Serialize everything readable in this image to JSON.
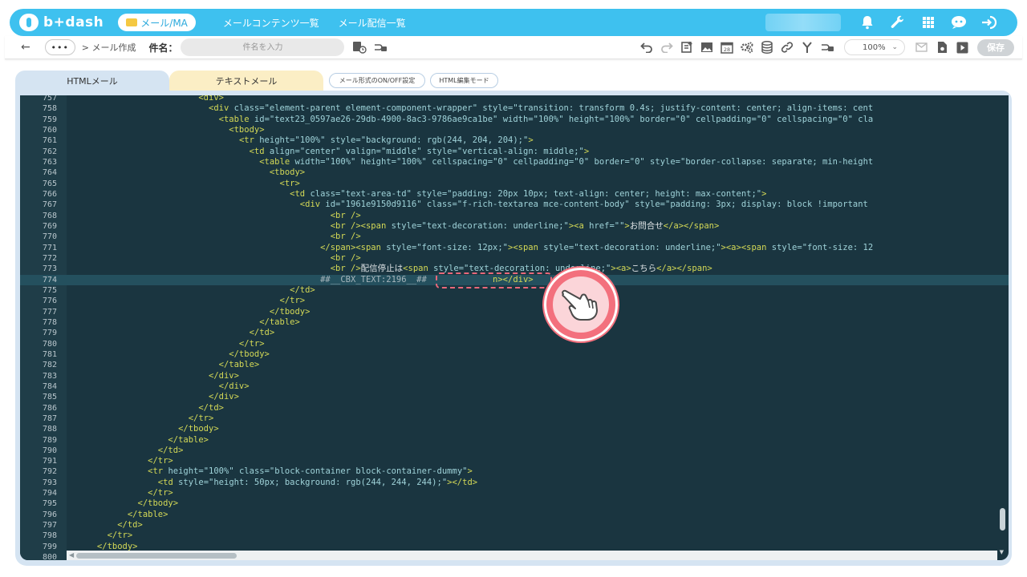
{
  "app": {
    "logo_text": "b+dash",
    "module": "メール/MA",
    "nav_links": [
      "メールコンテンツ一覧",
      "メール配信一覧"
    ]
  },
  "toolbar": {
    "back": "←",
    "breadcrumb": "> メール作成",
    "subject_label": "件名：",
    "subject_placeholder": "件名を入力",
    "zoom": "100%",
    "save": "保存"
  },
  "tabs": {
    "html": "HTMLメール",
    "text": "テキストメール",
    "toggle_format": "メール形式のON/OFF設定",
    "html_edit_mode": "HTML編集モード"
  },
  "editor": {
    "active_line": 774,
    "lines": [
      {
        "n": "757",
        "html": "<span class=\"tag\">                          &lt;div&gt;</span>"
      },
      {
        "n": "758",
        "html": "                            <span class=\"tag\">&lt;div </span><span class=\"attr\">class=</span><span class=\"str\">\"element-parent element-component-wrapper\"</span><span class=\"attr\"> style=</span><span class=\"str\">\"transition: transform 0.4s; justify-content: center; align-items: cent</span>"
      },
      {
        "n": "759",
        "html": "                              <span class=\"tag\">&lt;table </span><span class=\"attr\">id=</span><span class=\"str\">\"text23_0597ae26-29db-4900-8ac3-9786ae9ca1be\"</span><span class=\"attr\"> width=</span><span class=\"str\">\"100%\"</span><span class=\"attr\"> height=</span><span class=\"str\">\"100%\"</span><span class=\"attr\"> border=</span><span class=\"str\">\"0\"</span><span class=\"attr\"> cellpadding=</span><span class=\"str\">\"0\"</span><span class=\"attr\"> cellspacing=</span><span class=\"str\">\"0\"</span><span class=\"attr\"> cla</span>"
      },
      {
        "n": "760",
        "html": "<span class=\"tag\">                                &lt;tbody&gt;</span>"
      },
      {
        "n": "761",
        "html": "                                  <span class=\"tag\">&lt;tr </span><span class=\"attr\">height=</span><span class=\"str\">\"100%\"</span><span class=\"attr\"> style=</span><span class=\"str\">\"background: rgb(244, 204, 204);\"</span><span class=\"tag\">&gt;</span>"
      },
      {
        "n": "762",
        "html": "                                    <span class=\"tag\">&lt;td </span><span class=\"attr\">align=</span><span class=\"str\">\"center\"</span><span class=\"attr\"> valign=</span><span class=\"str\">\"middle\"</span><span class=\"attr\"> style=</span><span class=\"str\">\"vertical-align: middle;\"</span><span class=\"tag\">&gt;</span>"
      },
      {
        "n": "763",
        "html": "                                      <span class=\"tag\">&lt;table </span><span class=\"attr\">width=</span><span class=\"str\">\"100%\"</span><span class=\"attr\"> height=</span><span class=\"str\">\"100%\"</span><span class=\"attr\"> cellspacing=</span><span class=\"str\">\"0\"</span><span class=\"attr\"> cellpadding=</span><span class=\"str\">\"0\"</span><span class=\"attr\"> border=</span><span class=\"str\">\"0\"</span><span class=\"attr\"> style=</span><span class=\"str\">\"border-collapse: separate; min-height</span>"
      },
      {
        "n": "764",
        "html": "<span class=\"tag\">                                        &lt;tbody&gt;</span>"
      },
      {
        "n": "765",
        "html": "<span class=\"tag\">                                          &lt;tr&gt;</span>"
      },
      {
        "n": "766",
        "html": "                                            <span class=\"tag\">&lt;td </span><span class=\"attr\">class=</span><span class=\"str\">\"text-area-td\"</span><span class=\"attr\"> style=</span><span class=\"str\">\"padding: 20px 10px; text-align: center; height: max-content;\"</span><span class=\"tag\">&gt;</span>"
      },
      {
        "n": "767",
        "html": "                                              <span class=\"tag\">&lt;div </span><span class=\"attr\">id=</span><span class=\"str\">\"1961e9150d9116\"</span><span class=\"attr\"> class=</span><span class=\"str\">\"f-rich-textarea mce-content-body\"</span><span class=\"attr\"> style=</span><span class=\"str\">\"padding: 3px; display: block !important</span>"
      },
      {
        "n": "768",
        "html": "<span class=\"tag\">                                                    &lt;br /&gt;</span>"
      },
      {
        "n": "769",
        "html": "                                                    <span class=\"tag\">&lt;br /&gt;&lt;span </span><span class=\"attr\">style=</span><span class=\"str\">\"text-decoration: underline;\"</span><span class=\"tag\">&gt;&lt;a </span><span class=\"attr\">href=</span><span class=\"str\">\"\"</span><span class=\"tag\">&gt;</span><span class=\"plain\">お問合せ</span><span class=\"tag\">&lt;/a&gt;&lt;/span&gt;</span>"
      },
      {
        "n": "770",
        "html": "<span class=\"tag\">                                                    &lt;br /&gt;</span>"
      },
      {
        "n": "771",
        "html": "                                                  <span class=\"tag\">&lt;/span&gt;&lt;span </span><span class=\"attr\">style=</span><span class=\"str\">\"font-size: 12px;\"</span><span class=\"tag\">&gt;&lt;span </span><span class=\"attr\">style=</span><span class=\"str\">\"text-decoration: underline;\"</span><span class=\"tag\">&gt;&lt;a&gt;&lt;span </span><span class=\"attr\">style=</span><span class=\"str\">\"font-size: 12</span>"
      },
      {
        "n": "772",
        "html": "<span class=\"tag\">                                                    &lt;br /&gt;</span>"
      },
      {
        "n": "773",
        "html": "                                                    <span class=\"tag\">&lt;br /&gt;</span><span class=\"plain\">配信停止は</span><span class=\"tag\">&lt;span </span><span class=\"attr\">style=</span><span class=\"str\">\"text-decoration: underline;\"</span><span class=\"tag\">&gt;&lt;a&gt;</span><span class=\"plain\">こちら</span><span class=\"tag\">&lt;/a&gt;&lt;/span&gt;</span>"
      },
      {
        "n": "774",
        "html": "                                                  <span class=\"hi\">##__CBX_TEXT:2196__##</span>             <span class=\"tag\">n&gt;&lt;/div&gt;</span>"
      },
      {
        "n": "775",
        "html": "<span class=\"tag\">                                            &lt;/td&gt;</span>"
      },
      {
        "n": "776",
        "html": "<span class=\"tag\">                                          &lt;/tr&gt;</span>"
      },
      {
        "n": "777",
        "html": "<span class=\"tag\">                                        &lt;/tbody&gt;</span>"
      },
      {
        "n": "778",
        "html": "<span class=\"tag\">                                      &lt;/table&gt;</span>"
      },
      {
        "n": "779",
        "html": "<span class=\"tag\">                                    &lt;/td&gt;</span>"
      },
      {
        "n": "780",
        "html": "<span class=\"tag\">                                  &lt;/tr&gt;</span>"
      },
      {
        "n": "781",
        "html": "<span class=\"tag\">                                &lt;/tbody&gt;</span>"
      },
      {
        "n": "782",
        "html": "<span class=\"tag\">                              &lt;/table&gt;</span>"
      },
      {
        "n": "783",
        "html": "<span class=\"tag\">                            &lt;/div&gt;</span>"
      },
      {
        "n": "784",
        "html": "<span class=\"tag\">                              &lt;/div&gt;</span>"
      },
      {
        "n": "785",
        "html": "<span class=\"tag\">                            &lt;/div&gt;</span>"
      },
      {
        "n": "786",
        "html": "<span class=\"tag\">                          &lt;/td&gt;</span>"
      },
      {
        "n": "787",
        "html": "<span class=\"tag\">                        &lt;/tr&gt;</span>"
      },
      {
        "n": "788",
        "html": "<span class=\"tag\">                      &lt;/tbody&gt;</span>"
      },
      {
        "n": "789",
        "html": "<span class=\"tag\">                    &lt;/table&gt;</span>"
      },
      {
        "n": "790",
        "html": "<span class=\"tag\">                  &lt;/td&gt;</span>"
      },
      {
        "n": "791",
        "html": "<span class=\"tag\">                &lt;/tr&gt;</span>"
      },
      {
        "n": "792",
        "html": "                <span class=\"tag\">&lt;tr </span><span class=\"attr\">height=</span><span class=\"str\">\"100%\"</span><span class=\"attr\"> class=</span><span class=\"str\">\"block-container block-container-dummy\"</span><span class=\"tag\">&gt;</span>"
      },
      {
        "n": "793",
        "html": "                  <span class=\"tag\">&lt;td </span><span class=\"attr\">style=</span><span class=\"str\">\"height: 50px; background: rgb(244, 244, 244);\"</span><span class=\"tag\">&gt;&lt;/td&gt;</span>"
      },
      {
        "n": "794",
        "html": "<span class=\"tag\">                &lt;/tr&gt;</span>"
      },
      {
        "n": "795",
        "html": "<span class=\"tag\">              &lt;/tbody&gt;</span>"
      },
      {
        "n": "796",
        "html": "<span class=\"tag\">            &lt;/table&gt;</span>"
      },
      {
        "n": "797",
        "html": "<span class=\"tag\">          &lt;/td&gt;</span>"
      },
      {
        "n": "798",
        "html": "<span class=\"tag\">        &lt;/tr&gt;</span>"
      },
      {
        "n": "799",
        "html": "<span class=\"tag\">      &lt;/tbody&gt;</span>"
      },
      {
        "n": "800",
        "html": "<span class=\"tag\">    &lt;/table&gt;</span>"
      }
    ]
  },
  "colors": {
    "brand": "#3ec1ef",
    "editor_bg": "#1a3540",
    "highlight": "#f3707d"
  },
  "icons": {
    "nav": [
      "bell-icon",
      "wrench-icon",
      "grid-icon",
      "ai-icon",
      "logout-icon"
    ],
    "toolbar": [
      "undo-icon",
      "redo-icon",
      "add-content-icon",
      "image-icon",
      "calendar-icon",
      "gear-group-icon",
      "database-icon",
      "link-icon",
      "branch-icon",
      "key-link-icon",
      "mail-icon",
      "document-icon",
      "play-icon"
    ]
  }
}
